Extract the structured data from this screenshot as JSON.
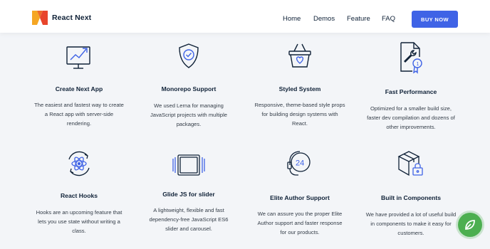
{
  "brand": {
    "name": "React Next"
  },
  "nav": [
    {
      "label": "Home"
    },
    {
      "label": "Demos"
    },
    {
      "label": "Feature"
    },
    {
      "label": "FAQ"
    }
  ],
  "cta": {
    "label": "BUY NOW"
  },
  "colors": {
    "accent": "#3f63e6",
    "chat": "#4caf50",
    "heading": "#0f2137"
  },
  "features": [
    {
      "icon": "monitor-chart-icon",
      "title": "Create Next App",
      "desc": [
        "The easiest and fastest way to create",
        "a React app with server-side",
        "rendering."
      ]
    },
    {
      "icon": "shield-check-icon",
      "title": "Monorepo Support",
      "desc": [
        "We used Lerna for managing",
        "JavaScript projects with multiple",
        "packages."
      ]
    },
    {
      "icon": "basket-heart-icon",
      "title": "Styled System",
      "desc": [
        "Responsive, theme-based style props",
        "for building design systems with",
        "React."
      ]
    },
    {
      "icon": "wrench-badge-icon",
      "title": "Fast Performance",
      "desc": [
        "Optimized for a smaller build size,",
        "faster dev compilation and dozens of",
        "other improvements."
      ]
    },
    {
      "icon": "react-atom-icon",
      "title": "React Hooks",
      "desc": [
        "Hooks are an upcoming feature that",
        "lets you use state without writing a",
        "class."
      ]
    },
    {
      "icon": "slider-icon",
      "title": "Glide JS for slider",
      "desc": [
        "A lightweight, flexible and fast",
        "dependency-free JavaScript ES6",
        "slider and carousel."
      ]
    },
    {
      "icon": "headset-24-icon",
      "title": "Elite Author Support",
      "desc": [
        "We can assure you the proper Elite",
        "Author support and faster response",
        "for our products."
      ]
    },
    {
      "icon": "box-lock-icon",
      "title": "Built in Components",
      "desc": [
        "We have provided a lot of useful build",
        "in components to make it easy for",
        "customers."
      ]
    }
  ]
}
